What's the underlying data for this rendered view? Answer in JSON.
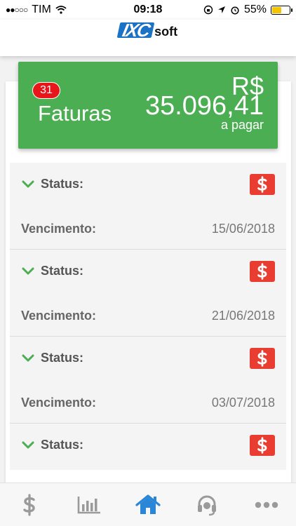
{
  "status_bar": {
    "carrier": "TIM",
    "time": "09:18",
    "battery": "55%",
    "battery_level": 0.55
  },
  "summary": {
    "badge_count": "31",
    "label": "Faturas",
    "currency": "R$",
    "amount": "35.096,41",
    "sublabel": "a pagar",
    "color": "#4cae52"
  },
  "invoices": [
    {
      "status_label": "Status:",
      "due_label": "Vencimento:",
      "due_date": "15/06/2018",
      "action_icon": "dollar-icon"
    },
    {
      "status_label": "Status:",
      "due_label": "Vencimento:",
      "due_date": "21/06/2018",
      "action_icon": "dollar-icon"
    },
    {
      "status_label": "Status:",
      "due_label": "Vencimento:",
      "due_date": "03/07/2018",
      "action_icon": "dollar-icon"
    },
    {
      "status_label": "Status:",
      "due_label": "",
      "due_date": "",
      "action_icon": "dollar-icon"
    }
  ],
  "bottom_nav": {
    "items": [
      {
        "icon": "dollar-icon",
        "active": false
      },
      {
        "icon": "bar-chart-icon",
        "active": false
      },
      {
        "icon": "home-icon",
        "active": true
      },
      {
        "icon": "headset-icon",
        "active": false
      },
      {
        "icon": "more-icon",
        "active": false
      }
    ],
    "active_color": "#2a86d6",
    "inactive_color": "#9a9a9a"
  },
  "colors": {
    "pay_button": "#ea3d31",
    "chevron": "#4cae52"
  }
}
